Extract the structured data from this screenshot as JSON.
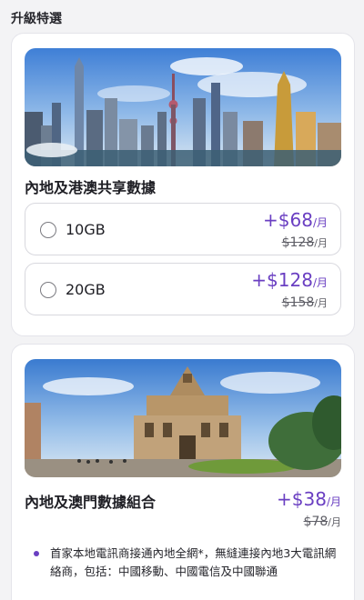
{
  "section": {
    "title": "升級特選"
  },
  "card1": {
    "title": "內地及港澳共享數據",
    "options": [
      {
        "label": "10GB",
        "price": "+$68",
        "unit": "/月",
        "old_price": "$128",
        "old_unit": "/月"
      },
      {
        "label": "20GB",
        "price": "+$128",
        "unit": "/月",
        "old_price": "$158",
        "old_unit": "/月"
      }
    ]
  },
  "card2": {
    "title": "內地及澳門數據組合",
    "price": "+$38",
    "unit": "/月",
    "old_price": "$78",
    "old_unit": "/月",
    "bullets": [
      "首家本地電訊商接通內地全網*，無縫連接內地3大電訊網絡商，包括：中國移動、中國電信及中國聯通"
    ]
  },
  "colors": {
    "accent": "#6a3fc2",
    "card_bg": "#ffffff",
    "page_bg": "#f3f3f5"
  },
  "icons": {
    "radio": "radio-unselected-icon",
    "bullet": "bullet-dot-icon"
  }
}
